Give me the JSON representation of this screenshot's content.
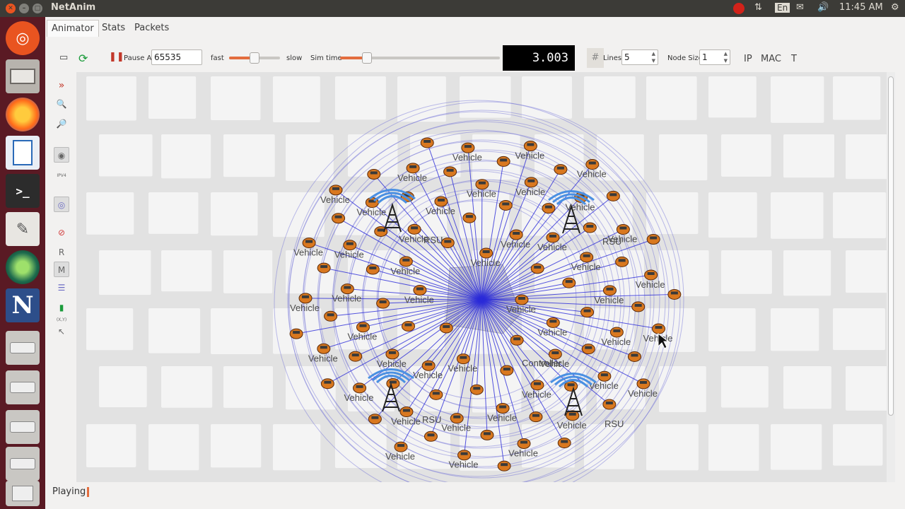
{
  "top_panel": {
    "app_title": "NetAnim",
    "keyboard_layout": "En",
    "clock": "11:45 AM"
  },
  "launcher": {
    "icons": [
      "ubuntu-dash-icon",
      "files-drive-icon",
      "firefox-icon",
      "libreoffice-writer-icon",
      "terminal-icon",
      "text-editor-icon",
      "globe-app-icon",
      "netanim-icon",
      "drive-icon",
      "drive-icon",
      "drive-icon",
      "drive-icon",
      "trash-icon"
    ],
    "netanim_letter": "N"
  },
  "tabs": [
    {
      "label": "Animator",
      "active": true
    },
    {
      "label": "Stats",
      "active": false
    },
    {
      "label": "Packets",
      "active": false
    }
  ],
  "toolbar": {
    "pause_at_label": "Pause At",
    "pause_at_value": "65535",
    "fast_label": "fast",
    "slow_label": "slow",
    "speed_level": 0.5,
    "sim_time_label": "Sim time",
    "sim_time_level": 0.17,
    "sim_time_display": "3.003",
    "grid_symbol": "#",
    "lines_label": "Lines",
    "lines_value": "5",
    "node_size_label": "Node Size",
    "node_size_value": "1",
    "ip_label": "IP",
    "mac_label": "MAC",
    "t_label": "T"
  },
  "left_tools": {
    "reset_label": "R",
    "mobility_label": "M",
    "xy_label": "(X,Y)",
    "ipv4_label": "IPV4"
  },
  "scene": {
    "controller_label": "Controller",
    "rsu_label": "RSU",
    "vehicle_label": "Vehicle",
    "rsu_count": 4,
    "vehicle_count": 90
  },
  "status": {
    "text": "Playing"
  },
  "colors": {
    "accent": "#e36d3e",
    "link": "#2a2ad8",
    "wireless_ring": "#4a90e2"
  }
}
